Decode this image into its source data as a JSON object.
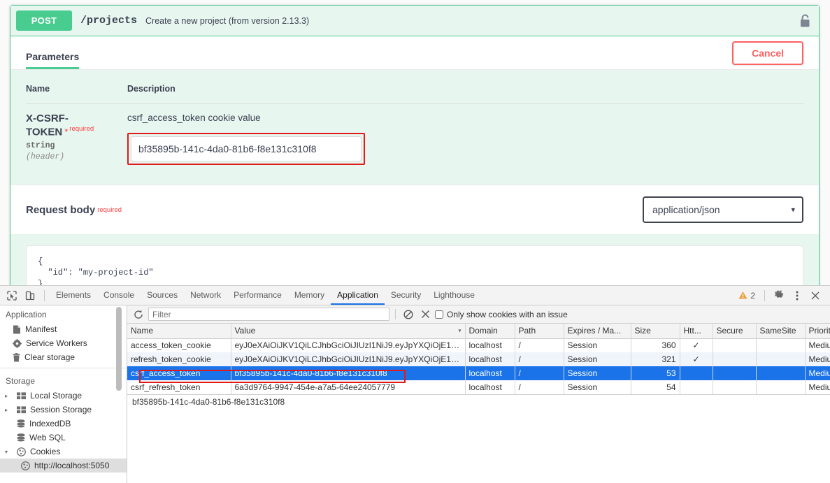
{
  "swagger": {
    "operation": {
      "method": "POST",
      "path": "/projects",
      "summary": "Create a new project (from version 2.13.3)",
      "lock_icon": "unlocked-padlock-icon"
    },
    "tabs": [
      {
        "label": "Parameters",
        "active": true
      }
    ],
    "cancel_label": "Cancel",
    "parameters": {
      "headers": {
        "name": "Name",
        "description": "Description"
      },
      "rows": [
        {
          "name": "X-CSRF-TOKEN",
          "required_star": "*",
          "required_label": "required",
          "type": "string",
          "location": "(header)",
          "description": "csrf_access_token cookie value",
          "input_value": "bf35895b-141c-4da0-81b6-f8e131c310f8",
          "input_placeholder": ""
        }
      ]
    },
    "request_body": {
      "label": "Request body",
      "required_label": "required",
      "media_type_selected": "application/json",
      "media_type_options": [
        "application/json"
      ],
      "caret_icon": "chevron-down-icon",
      "editor_content": "{\n  \"id\": \"my-project-id\"\n}"
    }
  },
  "devtools": {
    "toolbar_icons": [
      "inspect-element-icon",
      "device-toolbar-icon"
    ],
    "tabs": [
      {
        "label": "Elements",
        "active": false
      },
      {
        "label": "Console",
        "active": false
      },
      {
        "label": "Sources",
        "active": false
      },
      {
        "label": "Network",
        "active": false
      },
      {
        "label": "Performance",
        "active": false
      },
      {
        "label": "Memory",
        "active": false
      },
      {
        "label": "Application",
        "active": true
      },
      {
        "label": "Security",
        "active": false
      },
      {
        "label": "Lighthouse",
        "active": false
      }
    ],
    "warning_count": "2",
    "warning_icon": "warning-triangle-icon",
    "settings_icon": "gear-icon",
    "more_icon": "kebab-menu-icon",
    "close_icon": "close-icon",
    "sidebar": {
      "application_group": "Application",
      "application_items": [
        {
          "label": "Manifest",
          "icon": "document-icon"
        },
        {
          "label": "Service Workers",
          "icon": "gear-icon"
        },
        {
          "label": "Clear storage",
          "icon": "trash-icon"
        }
      ],
      "storage_group": "Storage",
      "storage_items": [
        {
          "label": "Local Storage",
          "icon": "table-icon",
          "twisty": "▸",
          "expanded": false
        },
        {
          "label": "Session Storage",
          "icon": "table-icon",
          "twisty": "▸",
          "expanded": false
        },
        {
          "label": "IndexedDB",
          "icon": "database-icon",
          "twisty": "",
          "expanded": false
        },
        {
          "label": "Web SQL",
          "icon": "database-icon",
          "twisty": "",
          "expanded": false
        },
        {
          "label": "Cookies",
          "icon": "cookie-icon",
          "twisty": "▾",
          "expanded": true
        }
      ],
      "cookie_origins": [
        {
          "label": "http://localhost:5050",
          "icon": "cookie-icon",
          "selected": true
        }
      ]
    },
    "cookie_toolbar": {
      "refresh_icon": "refresh-icon",
      "filter_placeholder": "Filter",
      "filter_value": "",
      "clear_icon": "block-clear-icon",
      "delete_icon": "close-x-icon",
      "only_issue_label": "Only show cookies with an issue",
      "only_issue_checked": false
    },
    "cookie_table": {
      "columns": [
        "Name",
        "Value",
        "Domain",
        "Path",
        "Expires / Ma...",
        "Size",
        "Htt...",
        "Secure",
        "SameSite",
        "Priority"
      ],
      "sorted_column": "Value",
      "sort_caret": "▾",
      "rows": [
        {
          "name": "access_token_cookie",
          "value": "eyJ0eXAiOiJKV1QiLCJhbGciOiJIUzI1NiJ9.eyJpYXQiOjE1OT...",
          "domain": "localhost",
          "path": "/",
          "expires": "Session",
          "size": "360",
          "httponly": "✓",
          "secure": "",
          "samesite": "",
          "priority": "Medium",
          "selected": false
        },
        {
          "name": "refresh_token_cookie",
          "value": "eyJ0eXAiOiJKV1QiLCJhbGciOiJIUzI1NiJ9.eyJpYXQiOjE1OT...",
          "domain": "localhost",
          "path": "/",
          "expires": "Session",
          "size": "321",
          "httponly": "✓",
          "secure": "",
          "samesite": "",
          "priority": "Medium",
          "selected": false
        },
        {
          "name": "csrf_access_token",
          "value": "bf35895b-141c-4da0-81b6-f8e131c310f8",
          "domain": "localhost",
          "path": "/",
          "expires": "Session",
          "size": "53",
          "httponly": "",
          "secure": "",
          "samesite": "",
          "priority": "Medium",
          "selected": true
        },
        {
          "name": "csrf_refresh_token",
          "value": "6a3d9764-9947-454e-a7a5-64ee24057779",
          "domain": "localhost",
          "path": "/",
          "expires": "Session",
          "size": "54",
          "httponly": "",
          "secure": "",
          "samesite": "",
          "priority": "Medium",
          "selected": false
        }
      ]
    },
    "cookie_detail_value": "bf35895b-141c-4da0-81b6-f8e131c310f8"
  },
  "colors": {
    "post_green": "#49cc90",
    "swagger_tint": "#e8f6f0",
    "cancel_red": "#ff6060",
    "highlight_red": "#e01b1b",
    "devtools_selection_blue": "#1a73e8",
    "warning_amber": "#e8a33d"
  }
}
